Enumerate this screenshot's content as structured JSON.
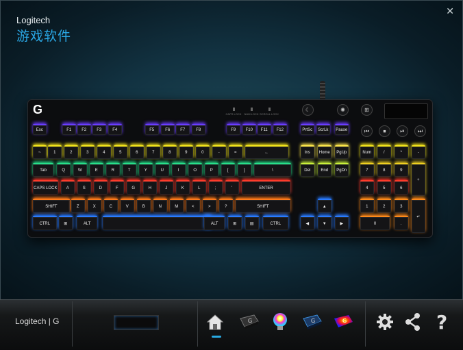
{
  "window": {
    "brand": "Logitech",
    "subtitle": "游戏软件",
    "close_glyph": "✕"
  },
  "keyboard": {
    "logo": "G",
    "indicators": [
      "CAPS LOCK",
      "NUM LOCK",
      "SCROLL LOCK"
    ],
    "buttons": [
      "☾",
      "✺",
      "⊞"
    ],
    "media": [
      "⏮",
      "⏹",
      "⏯",
      "⏭"
    ]
  },
  "rows": [
    [
      "Esc",
      "F1",
      "F2",
      "F3",
      "F4",
      "F5",
      "F6",
      "F7",
      "F8",
      "F9",
      "F10",
      "F11",
      "F12",
      "PrtSc",
      "ScrLk",
      "Pause"
    ],
    [
      "~",
      "1",
      "2",
      "3",
      "4",
      "5",
      "6",
      "7",
      "8",
      "9",
      "0",
      "-",
      "=",
      "←",
      "Ins",
      "Home",
      "PgUp",
      "Num",
      "/",
      "*",
      "-"
    ],
    [
      "Tab",
      "Q",
      "W",
      "E",
      "R",
      "T",
      "Y",
      "U",
      "I",
      "O",
      "P",
      "[",
      "]",
      "\\",
      "Del",
      "End",
      "PgDn",
      "7",
      "8",
      "9",
      "+"
    ],
    [
      "CAPS LOCK",
      "A",
      "S",
      "D",
      "F",
      "G",
      "H",
      "J",
      "K",
      "L",
      ";",
      "'",
      "ENTER",
      "4",
      "5",
      "6"
    ],
    [
      "SHIFT",
      "Z",
      "X",
      "C",
      "V",
      "B",
      "N",
      "M",
      "<",
      ">",
      "?",
      "SHIFT",
      "▲",
      "1",
      "2",
      "3",
      "↵"
    ],
    [
      "CTRL",
      "⊞",
      "ALT",
      "",
      "ALT",
      "⊞",
      "▤",
      "CTRL",
      "◀",
      "▼",
      "▶",
      "0",
      "."
    ]
  ],
  "bottom": {
    "logo_text": "Logitech | G",
    "nav": [
      "home-icon",
      "g-key-icon",
      "lighting-bulb-icon",
      "g-key-blue-icon",
      "heatmap-icon",
      "settings-gear-icon",
      "share-icon",
      "help-icon"
    ]
  },
  "colors": {
    "accent": "#29aae2"
  }
}
